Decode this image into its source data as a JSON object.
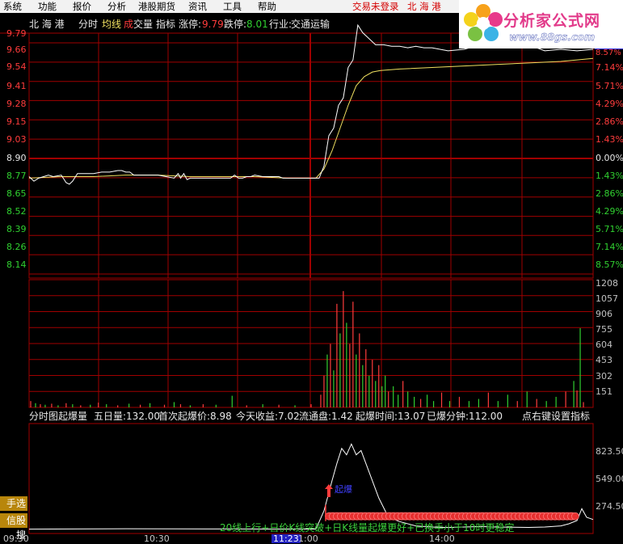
{
  "menubar": {
    "items": [
      "系统",
      "功能",
      "报价",
      "分析",
      "港股期货",
      "资讯",
      "工具",
      "帮助"
    ],
    "status_login": "交易未登录",
    "status_stock": "北 海 港"
  },
  "logo": {
    "name": "分析家公式网",
    "url": "www.88gs.com"
  },
  "infobar": {
    "stock_name": "北 海 港",
    "mode": "分时",
    "avg_label": "均线",
    "vol_label_a": "成",
    "vol_label_b": "交量",
    "indicator_label": "指标",
    "limit_up_label": "涨停:",
    "limit_up_value": "9.79",
    "limit_down_label": "跌停:",
    "limit_down_value": "8.01",
    "industry_label": "行业:",
    "industry_value": "交通运输"
  },
  "price_axis": {
    "up": [
      "9.79",
      "9.66",
      "9.54",
      "9.41",
      "9.28",
      "9.15",
      "9.03"
    ],
    "base": "8.90",
    "down": [
      "8.77",
      "8.65",
      "8.52",
      "8.39",
      "8.26",
      "8.14"
    ]
  },
  "pct_axis": {
    "up": [
      "8.57%",
      "7.14%",
      "5.71%",
      "4.29%",
      "2.86%",
      "1.43%"
    ],
    "base": "0.00%",
    "down": [
      "1.43%",
      "2.86%",
      "4.29%",
      "5.71%",
      "7.14%",
      "8.57%"
    ]
  },
  "volume_axis": [
    "1208",
    "1057",
    "906",
    "755",
    "604",
    "453",
    "302",
    "151"
  ],
  "indicator_header": {
    "name": "分时图起爆量",
    "five_day": "五日量:132.00",
    "first_price": "首次起爆价:8.98",
    "today_gain": "今天收益:7.02",
    "float_cap": "流通盘:1.42",
    "burst_time": "起爆时间:13.07",
    "burst_minutes": "已爆分钟:112.00",
    "hint": "点右键设置指标"
  },
  "indicator_axis": [
    "823.50",
    "549.00",
    "274.50"
  ],
  "side_buttons": [
    "手选股",
    "信股搜"
  ],
  "marker_text": "起爆",
  "condition_text": "20线上行+日价K线突破+日K线量起爆更好+已换手小于10时更稳定",
  "time_axis": {
    "t0": "09:30",
    "t1": "10:30",
    "t2": "11:23",
    "t3": "1:00",
    "t4": "14:00"
  },
  "colors": {
    "grid": "#a00000",
    "up": "#ff3c3c",
    "down": "#30d030",
    "price": "#ffffff",
    "avg": "#f0e060",
    "accent": "#ff3c3c"
  },
  "chart_data": {
    "type": "line",
    "price": {
      "base": 8.9,
      "ylim": [
        8.01,
        9.79
      ],
      "x": [
        0,
        6,
        12,
        18,
        24,
        30,
        40,
        46,
        50,
        54,
        60,
        70,
        80,
        90,
        100,
        110,
        115,
        120,
        125,
        130,
        140,
        150,
        160,
        170,
        180,
        185,
        188,
        192,
        196,
        200,
        210,
        220,
        230,
        240,
        250,
        255,
        260,
        265,
        270,
        275,
        280,
        290,
        300,
        310,
        315,
        320,
        325,
        330,
        334,
        338,
        342,
        346,
        350,
        356,
        360,
        366,
        372,
        378,
        384,
        390,
        396,
        402,
        408,
        414,
        420,
        430,
        440,
        450,
        460,
        470,
        480,
        490,
        500,
        520,
        540,
        560,
        580,
        600,
        620,
        640,
        660,
        680,
        700
      ],
      "y": [
        8.78,
        8.75,
        8.77,
        8.78,
        8.79,
        8.78,
        8.79,
        8.74,
        8.73,
        8.75,
        8.8,
        8.8,
        8.8,
        8.81,
        8.81,
        8.82,
        8.82,
        8.81,
        8.81,
        8.79,
        8.79,
        8.79,
        8.79,
        8.78,
        8.77,
        8.8,
        8.77,
        8.8,
        8.76,
        8.77,
        8.77,
        8.77,
        8.77,
        8.77,
        8.77,
        8.79,
        8.77,
        8.77,
        8.78,
        8.78,
        8.79,
        8.78,
        8.78,
        8.78,
        8.77,
        8.77,
        8.77,
        8.77,
        8.77,
        8.77,
        8.77,
        8.77,
        8.77,
        8.77,
        8.77,
        8.85,
        9.05,
        9.1,
        9.25,
        9.3,
        9.5,
        9.55,
        9.78,
        9.73,
        9.7,
        9.65,
        9.65,
        9.64,
        9.64,
        9.63,
        9.64,
        9.63,
        9.63,
        9.61,
        9.62,
        9.65,
        9.66,
        9.66,
        9.65,
        9.61,
        9.62,
        9.61,
        9.62
      ]
    },
    "avg_price": {
      "x": [
        0,
        40,
        80,
        120,
        160,
        200,
        240,
        280,
        320,
        356,
        366,
        376,
        386,
        396,
        406,
        416,
        426,
        436,
        460,
        500,
        540,
        580,
        620,
        660,
        700
      ],
      "y": [
        8.77,
        8.78,
        8.78,
        8.79,
        8.79,
        8.78,
        8.78,
        8.78,
        8.77,
        8.77,
        8.83,
        8.95,
        9.1,
        9.25,
        9.38,
        9.44,
        9.47,
        9.48,
        9.49,
        9.5,
        9.51,
        9.52,
        9.53,
        9.54,
        9.56
      ]
    },
    "volume": {
      "ylim": [
        0,
        1208
      ],
      "bars": [
        [
          2,
          60,
          "up"
        ],
        [
          8,
          40,
          "down"
        ],
        [
          14,
          30,
          "up"
        ],
        [
          20,
          25,
          "down"
        ],
        [
          28,
          35,
          "up"
        ],
        [
          36,
          20,
          "down"
        ],
        [
          46,
          40,
          "up"
        ],
        [
          54,
          30,
          "down"
        ],
        [
          64,
          20,
          "up"
        ],
        [
          76,
          25,
          "down"
        ],
        [
          86,
          45,
          "up"
        ],
        [
          96,
          30,
          "down"
        ],
        [
          110,
          20,
          "up"
        ],
        [
          124,
          35,
          "down"
        ],
        [
          138,
          25,
          "up"
        ],
        [
          150,
          40,
          "down"
        ],
        [
          168,
          25,
          "up"
        ],
        [
          180,
          50,
          "down"
        ],
        [
          188,
          30,
          "up"
        ],
        [
          200,
          20,
          "down"
        ],
        [
          216,
          30,
          "up"
        ],
        [
          232,
          25,
          "down"
        ],
        [
          252,
          110,
          "down"
        ],
        [
          270,
          20,
          "up"
        ],
        [
          290,
          30,
          "down"
        ],
        [
          310,
          25,
          "up"
        ],
        [
          330,
          20,
          "down"
        ],
        [
          350,
          30,
          "up"
        ],
        [
          362,
          120,
          "up"
        ],
        [
          366,
          300,
          "up"
        ],
        [
          370,
          500,
          "down"
        ],
        [
          374,
          600,
          "up"
        ],
        [
          378,
          350,
          "down"
        ],
        [
          382,
          980,
          "up"
        ],
        [
          386,
          700,
          "down"
        ],
        [
          390,
          1100,
          "up"
        ],
        [
          394,
          800,
          "down"
        ],
        [
          398,
          600,
          "up"
        ],
        [
          402,
          1000,
          "up"
        ],
        [
          406,
          500,
          "down"
        ],
        [
          410,
          700,
          "up"
        ],
        [
          414,
          400,
          "down"
        ],
        [
          418,
          550,
          "up"
        ],
        [
          422,
          300,
          "down"
        ],
        [
          426,
          450,
          "up"
        ],
        [
          430,
          250,
          "down"
        ],
        [
          434,
          400,
          "up"
        ],
        [
          438,
          200,
          "down"
        ],
        [
          442,
          300,
          "down"
        ],
        [
          446,
          150,
          "up"
        ],
        [
          452,
          200,
          "down"
        ],
        [
          458,
          120,
          "down"
        ],
        [
          464,
          250,
          "up"
        ],
        [
          470,
          150,
          "down"
        ],
        [
          478,
          100,
          "down"
        ],
        [
          486,
          80,
          "up"
        ],
        [
          494,
          120,
          "down"
        ],
        [
          502,
          60,
          "down"
        ],
        [
          512,
          140,
          "up"
        ],
        [
          522,
          60,
          "down"
        ],
        [
          534,
          100,
          "up"
        ],
        [
          546,
          60,
          "down"
        ],
        [
          558,
          80,
          "down"
        ],
        [
          570,
          140,
          "up"
        ],
        [
          582,
          60,
          "down"
        ],
        [
          594,
          120,
          "down"
        ],
        [
          606,
          60,
          "up"
        ],
        [
          618,
          150,
          "down"
        ],
        [
          630,
          80,
          "up"
        ],
        [
          642,
          60,
          "down"
        ],
        [
          654,
          100,
          "down"
        ],
        [
          666,
          150,
          "up"
        ],
        [
          676,
          250,
          "down"
        ],
        [
          680,
          160,
          "up"
        ],
        [
          684,
          750,
          "down"
        ],
        [
          688,
          50,
          "up"
        ]
      ]
    },
    "indicator": {
      "ylim": [
        0,
        960
      ],
      "x": [
        0,
        60,
        120,
        180,
        240,
        300,
        356,
        366,
        376,
        382,
        388,
        394,
        400,
        406,
        412,
        418,
        424,
        434,
        446,
        460,
        480,
        500,
        520,
        540,
        560,
        580,
        600,
        620,
        640,
        660,
        670,
        680,
        686,
        692,
        700
      ],
      "y": [
        10,
        12,
        14,
        13,
        12,
        11,
        11,
        180,
        460,
        620,
        760,
        700,
        800,
        700,
        740,
        620,
        500,
        300,
        120,
        80,
        40,
        30,
        25,
        30,
        35,
        30,
        28,
        26,
        30,
        40,
        60,
        90,
        200,
        120,
        100
      ],
      "ribbon": [
        368,
        680
      ],
      "ribbon_value": 130
    }
  }
}
